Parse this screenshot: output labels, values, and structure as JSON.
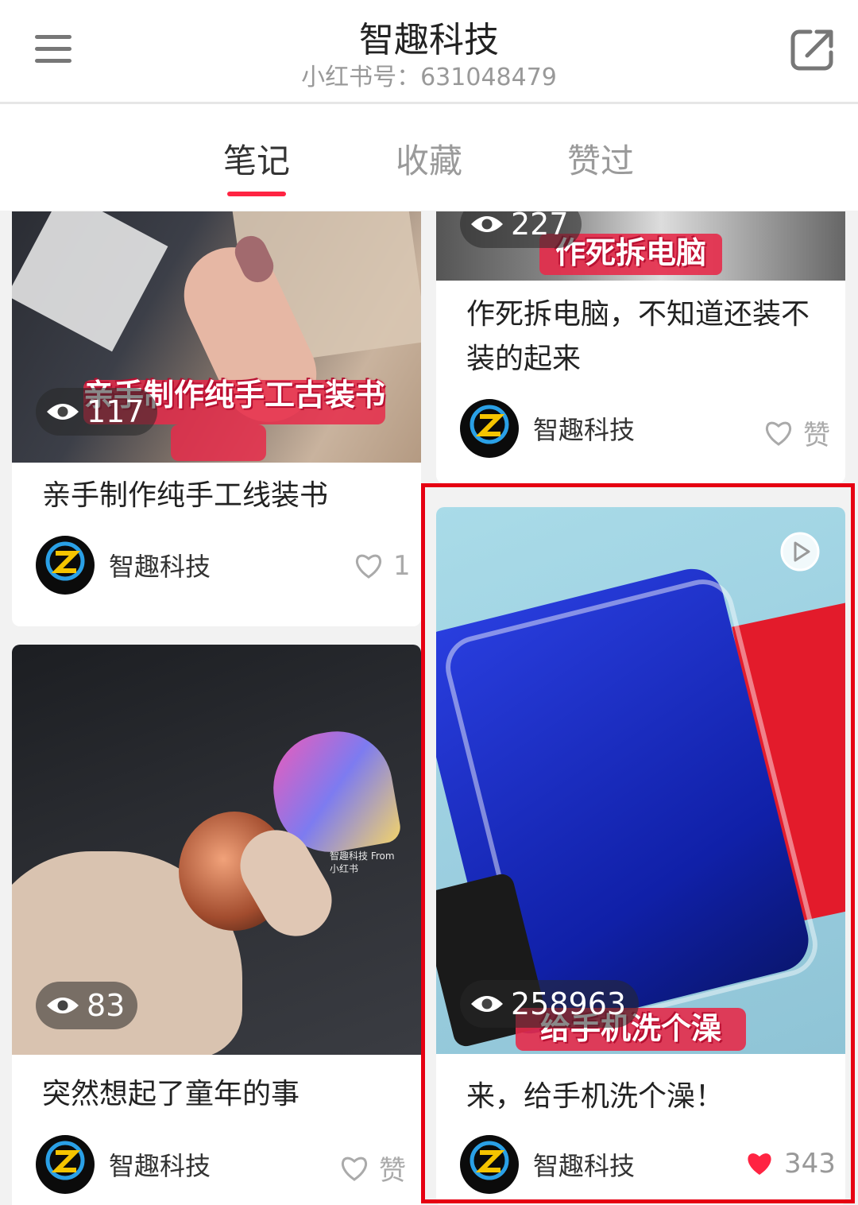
{
  "header": {
    "title": "智趣科技",
    "subtitle": "小红书号：631048479"
  },
  "tabs": [
    {
      "label": "笔记",
      "active": true
    },
    {
      "label": "收藏",
      "active": false
    },
    {
      "label": "赞过",
      "active": false
    }
  ],
  "notes": [
    {
      "views": "117",
      "banner": "亲手制作纯手工古装书",
      "title": "亲手制作纯手工线装书",
      "author": "智趣科技",
      "likes": "1",
      "liked": false
    },
    {
      "views": "227",
      "banner": "作死拆电脑",
      "title": "作死拆电脑，不知道还装不装的起来",
      "author": "智趣科技",
      "likes": "赞",
      "liked": false
    },
    {
      "views": "83",
      "watermark": "智趣科技 From 小红书",
      "title": "突然想起了童年的事",
      "author": "智趣科技",
      "likes": "赞",
      "liked": false
    },
    {
      "views": "258963",
      "banner": "给手机洗个澡",
      "title": "来，给手机洗个澡！",
      "author": "智趣科技",
      "likes": "343",
      "liked": true,
      "is_video": true
    }
  ],
  "avatar_label": "智趣科技",
  "colors": {
    "accent": "#ff2442",
    "highlight": "#e60012",
    "liked": "#ff2442"
  }
}
